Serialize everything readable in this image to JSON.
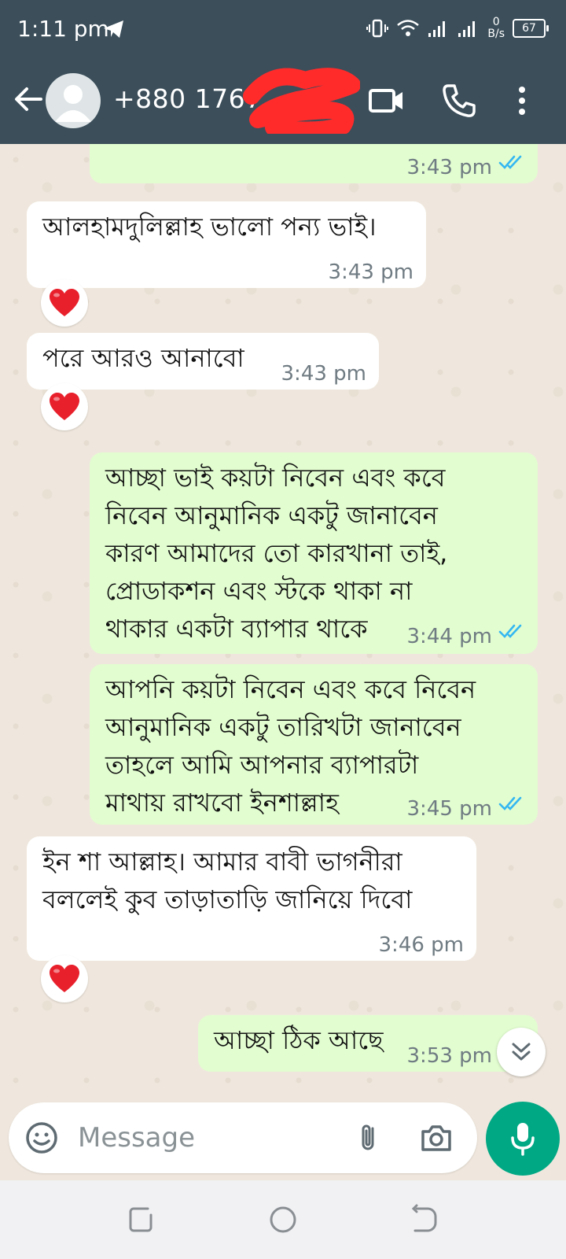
{
  "status_bar": {
    "time": "1:11 pm",
    "net_speed_value": "0",
    "net_speed_unit": "B/s",
    "battery": "67"
  },
  "header": {
    "contact_name": "+880 1767",
    "icons": [
      "back-arrow-icon",
      "avatar-icon",
      "video-call-icon",
      "phone-icon",
      "more-vert-icon"
    ]
  },
  "messages": [
    {
      "direction": "out",
      "text": "",
      "time": "3:43 pm",
      "read": true
    },
    {
      "direction": "in",
      "text": "আলহামদুলিল্লাহ ভালো পন্য ভাই।",
      "time": "3:43 pm",
      "reaction": "❤️"
    },
    {
      "direction": "in",
      "text": "পরে আরও আনাবো",
      "time": "3:43 pm",
      "reaction": "❤️"
    },
    {
      "direction": "out",
      "text": "আচ্ছা ভাই কয়টা নিবেন এবং কবে\nনিবেন আনুমানিক একটু জানাবেন\nকারণ আমাদের তো কারখানা তাই,\nপ্রোডাকশন এবং স্টকে থাকা না\nথাকার একটা ব্যাপার থাকে",
      "time": "3:44 pm",
      "read": true
    },
    {
      "direction": "out",
      "text": "আপনি কয়টা নিবেন এবং কবে নিবেন\nআনুমানিক একটু তারিখটা জানাবেন\nতাহলে আমি আপনার ব্যাপারটা\nমাথায় রাখবো ইনশাল্লাহ",
      "time": "3:45 pm",
      "read": true
    },
    {
      "direction": "in",
      "text": "ইন শা আল্লাহ। আমার বাবী ভাগনীরা\nবললেই  কুব তাড়াতাড়ি জানিয়ে দিবো",
      "time": "3:46 pm",
      "reaction": "❤️"
    },
    {
      "direction": "out",
      "text": "আচ্ছা ঠিক আছে",
      "time": "3:53 pm",
      "read": true
    }
  ],
  "composer": {
    "placeholder": "Message",
    "icons": [
      "emoji-icon",
      "attach-icon",
      "camera-icon",
      "mic-icon"
    ]
  },
  "colors": {
    "header_bg": "#3b4e5a",
    "chat_bg": "#efe7dd",
    "incoming_bubble": "#ffffff",
    "outgoing_bubble": "#e2fdd0",
    "read_ticks": "#34b7f1",
    "accent": "#00a884"
  }
}
